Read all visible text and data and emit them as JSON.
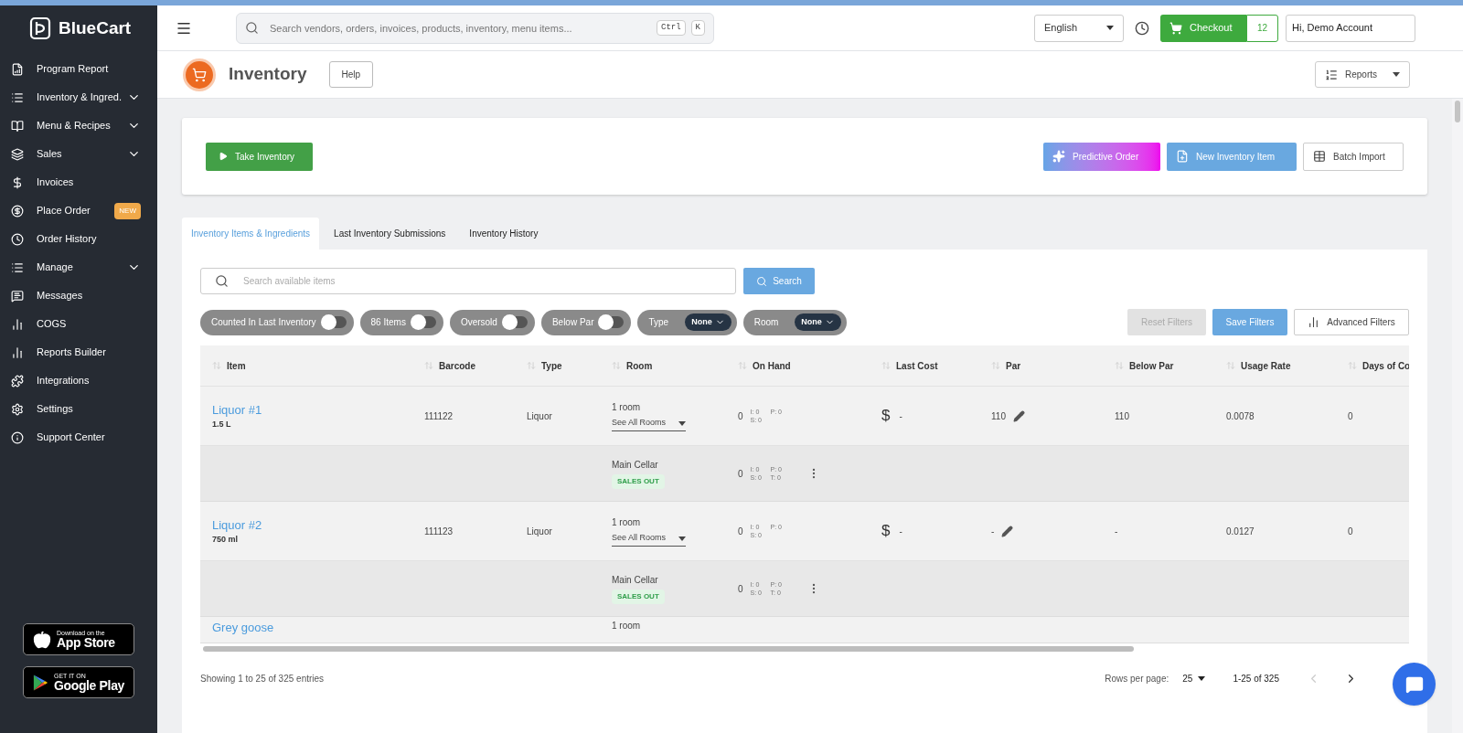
{
  "sidebar": {
    "logo": "BlueCart",
    "items": [
      {
        "label": "Program Report",
        "expandable": false
      },
      {
        "label": "Inventory & Ingred.",
        "expandable": true
      },
      {
        "label": "Menu & Recipes",
        "expandable": true
      },
      {
        "label": "Sales",
        "expandable": true
      },
      {
        "label": "Invoices",
        "expandable": false
      },
      {
        "label": "Place Order",
        "expandable": false,
        "badge": "NEW"
      },
      {
        "label": "Order History",
        "expandable": false
      },
      {
        "label": "Manage",
        "expandable": true
      },
      {
        "label": "Messages",
        "expandable": false
      },
      {
        "label": "COGS",
        "expandable": false
      },
      {
        "label": "Reports Builder",
        "expandable": false
      },
      {
        "label": "Integrations",
        "expandable": false
      },
      {
        "label": "Settings",
        "expandable": false
      },
      {
        "label": "Support Center",
        "expandable": false
      }
    ],
    "store_badges": [
      {
        "kind": "apple",
        "small": "Download on the",
        "big": "App Store"
      },
      {
        "kind": "google",
        "small": "GET IT ON",
        "big": "Google Play"
      }
    ]
  },
  "topbar": {
    "search_placeholder": "Search vendors, orders, invoices, products, inventory, menu items...",
    "shortcut": [
      "Ctrl",
      "K"
    ],
    "language": "English",
    "checkout": "Checkout",
    "cart_count": "12",
    "account": "Hi, Demo Account"
  },
  "page": {
    "title": "Inventory",
    "help": "Help",
    "reports": "Reports"
  },
  "actions": {
    "take_inventory": "Take Inventory",
    "buttons": [
      {
        "kind": "predictive",
        "label": "Predictive Order"
      },
      {
        "kind": "new",
        "label": "New Inventory Item"
      },
      {
        "kind": "batch",
        "label": "Batch Import"
      }
    ]
  },
  "tabs": [
    {
      "label": "Inventory Items & Ingredients",
      "selected": true
    },
    {
      "label": "Last Inventory Submissions",
      "selected": false
    },
    {
      "label": "Inventory History",
      "selected": false
    }
  ],
  "item_search": {
    "placeholder": "Search available items",
    "button": "Search"
  },
  "filters": [
    {
      "kind": "toggle",
      "label": "Counted In Last Inventory",
      "on": false
    },
    {
      "kind": "toggle",
      "label": "86 Items",
      "on": false
    },
    {
      "kind": "toggle",
      "label": "Oversold",
      "on": false
    },
    {
      "kind": "toggle",
      "label": "Below Par",
      "on": false
    },
    {
      "kind": "select",
      "label": "Type",
      "value": "None"
    },
    {
      "kind": "select",
      "label": "Room",
      "value": "None"
    }
  ],
  "filter_actions": {
    "reset": {
      "label": "Reset Filters",
      "disabled": true
    },
    "save": "Save Filters",
    "advanced": "Advanced Filters"
  },
  "table": {
    "columns": [
      "Item",
      "Barcode",
      "Type",
      "Room",
      "On Hand",
      "Last Cost",
      "Par",
      "Below Par",
      "Usage Rate",
      "Days of Co"
    ],
    "rows": [
      {
        "kind": "item",
        "name": "Liquor #1",
        "size": "1.5 L",
        "barcode": "111122",
        "type": "Liquor",
        "room_count": "1 room",
        "room_link": "See All Rooms",
        "on_hand": "0",
        "breakdown": [
          "I: 0",
          "P: 0",
          "S: 0"
        ],
        "currency": "$",
        "last_cost": "-",
        "par": "110",
        "below_par": "110",
        "usage_rate": "0.0078",
        "days": "0"
      },
      {
        "kind": "room",
        "room": "Main Cellar",
        "status": "SALES OUT",
        "on_hand": "0",
        "breakdown": [
          "I: 0",
          "P: 0",
          "S: 0",
          "T: 0"
        ]
      },
      {
        "kind": "item",
        "name": "Liquor #2",
        "size": "750 ml",
        "barcode": "111123",
        "type": "Liquor",
        "room_count": "1 room",
        "room_link": "See All Rooms",
        "on_hand": "0",
        "breakdown": [
          "I: 0",
          "P: 0",
          "S: 0"
        ],
        "currency": "$",
        "last_cost": "-",
        "par": "-",
        "below_par": "-",
        "usage_rate": "0.0127",
        "days": "0"
      },
      {
        "kind": "room",
        "room": "Main Cellar",
        "status": "SALES OUT",
        "on_hand": "0",
        "breakdown": [
          "I: 0",
          "P: 0",
          "S: 0",
          "T: 0"
        ]
      },
      {
        "kind": "partial",
        "name": "Grey goose",
        "room_count": "1 room"
      }
    ]
  },
  "footer": {
    "showing": "Showing 1 to 25 of 325 entries",
    "rows_label": "Rows per page:",
    "rows_value": "25",
    "range": "1-25 of 325",
    "prev_disabled": true,
    "next_disabled": false
  }
}
